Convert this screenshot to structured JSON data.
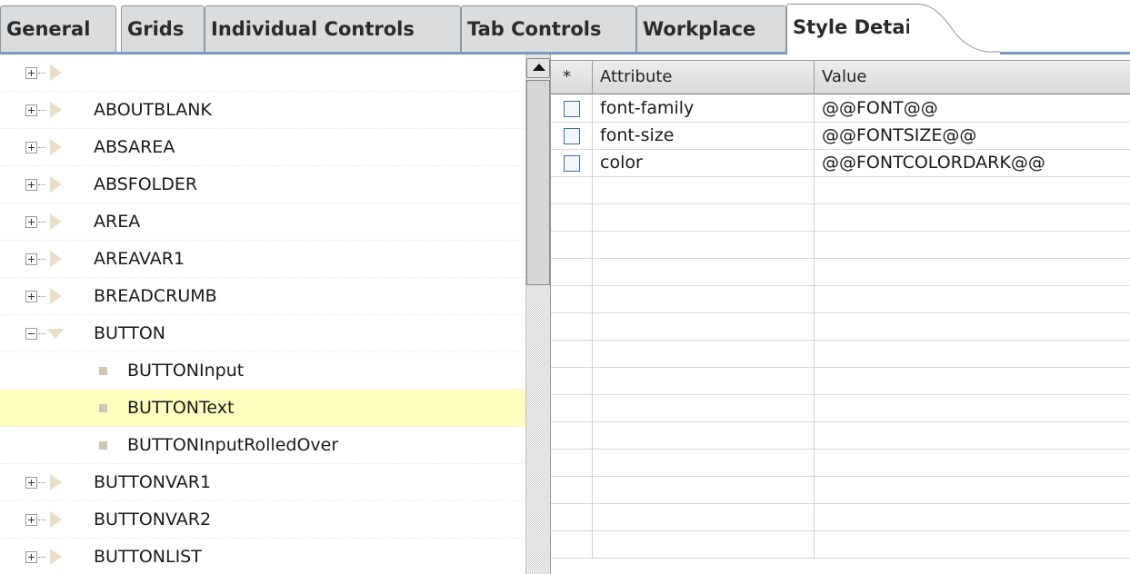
{
  "tabs": [
    {
      "label": "General",
      "active": false
    },
    {
      "label": "Grids",
      "active": false
    },
    {
      "label": "Individual Controls",
      "active": false
    },
    {
      "label": "Tab Controls",
      "active": false
    },
    {
      "label": "Workplace",
      "active": false
    },
    {
      "label": "Style Details",
      "active": true
    }
  ],
  "tree": {
    "items": [
      {
        "label": "",
        "type": "collapsed"
      },
      {
        "label": "ABOUTBLANK",
        "type": "collapsed"
      },
      {
        "label": "ABSAREA",
        "type": "collapsed"
      },
      {
        "label": "ABSFOLDER",
        "type": "collapsed"
      },
      {
        "label": "AREA",
        "type": "collapsed"
      },
      {
        "label": "AREAVAR1",
        "type": "collapsed"
      },
      {
        "label": "BREADCRUMB",
        "type": "collapsed"
      },
      {
        "label": "BUTTON",
        "type": "expanded"
      },
      {
        "label": "BUTTONInput",
        "type": "leaf"
      },
      {
        "label": "BUTTONText",
        "type": "leaf",
        "selected": true
      },
      {
        "label": "BUTTONInputRolledOver",
        "type": "leaf"
      },
      {
        "label": "BUTTONVAR1",
        "type": "collapsed"
      },
      {
        "label": "BUTTONVAR2",
        "type": "collapsed"
      },
      {
        "label": "BUTTONLIST",
        "type": "collapsed"
      }
    ]
  },
  "grid": {
    "headers": {
      "marker": "*",
      "attribute": "Attribute",
      "value": "Value"
    },
    "rows": [
      {
        "attribute": "font-family",
        "value": "@@FONT@@"
      },
      {
        "attribute": "font-size",
        "value": "@@FONTSIZE@@"
      },
      {
        "attribute": "color",
        "value": "@@FONTCOLORDARK@@"
      },
      {
        "attribute": "",
        "value": ""
      },
      {
        "attribute": "",
        "value": ""
      },
      {
        "attribute": "",
        "value": ""
      },
      {
        "attribute": "",
        "value": ""
      },
      {
        "attribute": "",
        "value": ""
      },
      {
        "attribute": "",
        "value": ""
      },
      {
        "attribute": "",
        "value": ""
      },
      {
        "attribute": "",
        "value": ""
      },
      {
        "attribute": "",
        "value": ""
      },
      {
        "attribute": "",
        "value": ""
      },
      {
        "attribute": "",
        "value": ""
      },
      {
        "attribute": "",
        "value": ""
      },
      {
        "attribute": "",
        "value": ""
      },
      {
        "attribute": "",
        "value": ""
      }
    ]
  },
  "colors": {
    "selection": "#ffffc0",
    "tree_arrow": "#e4dcc8",
    "tree_bullet": "#cbc6b5",
    "tab_inactive": "#dadcde",
    "checkbox_border": "#3f6f9f"
  },
  "icons": {
    "expander": "plus-minus-box-icon",
    "node": "triangle-arrow-icon",
    "leaf": "square-bullet-icon",
    "scroll_up": "arrow-up-icon"
  }
}
